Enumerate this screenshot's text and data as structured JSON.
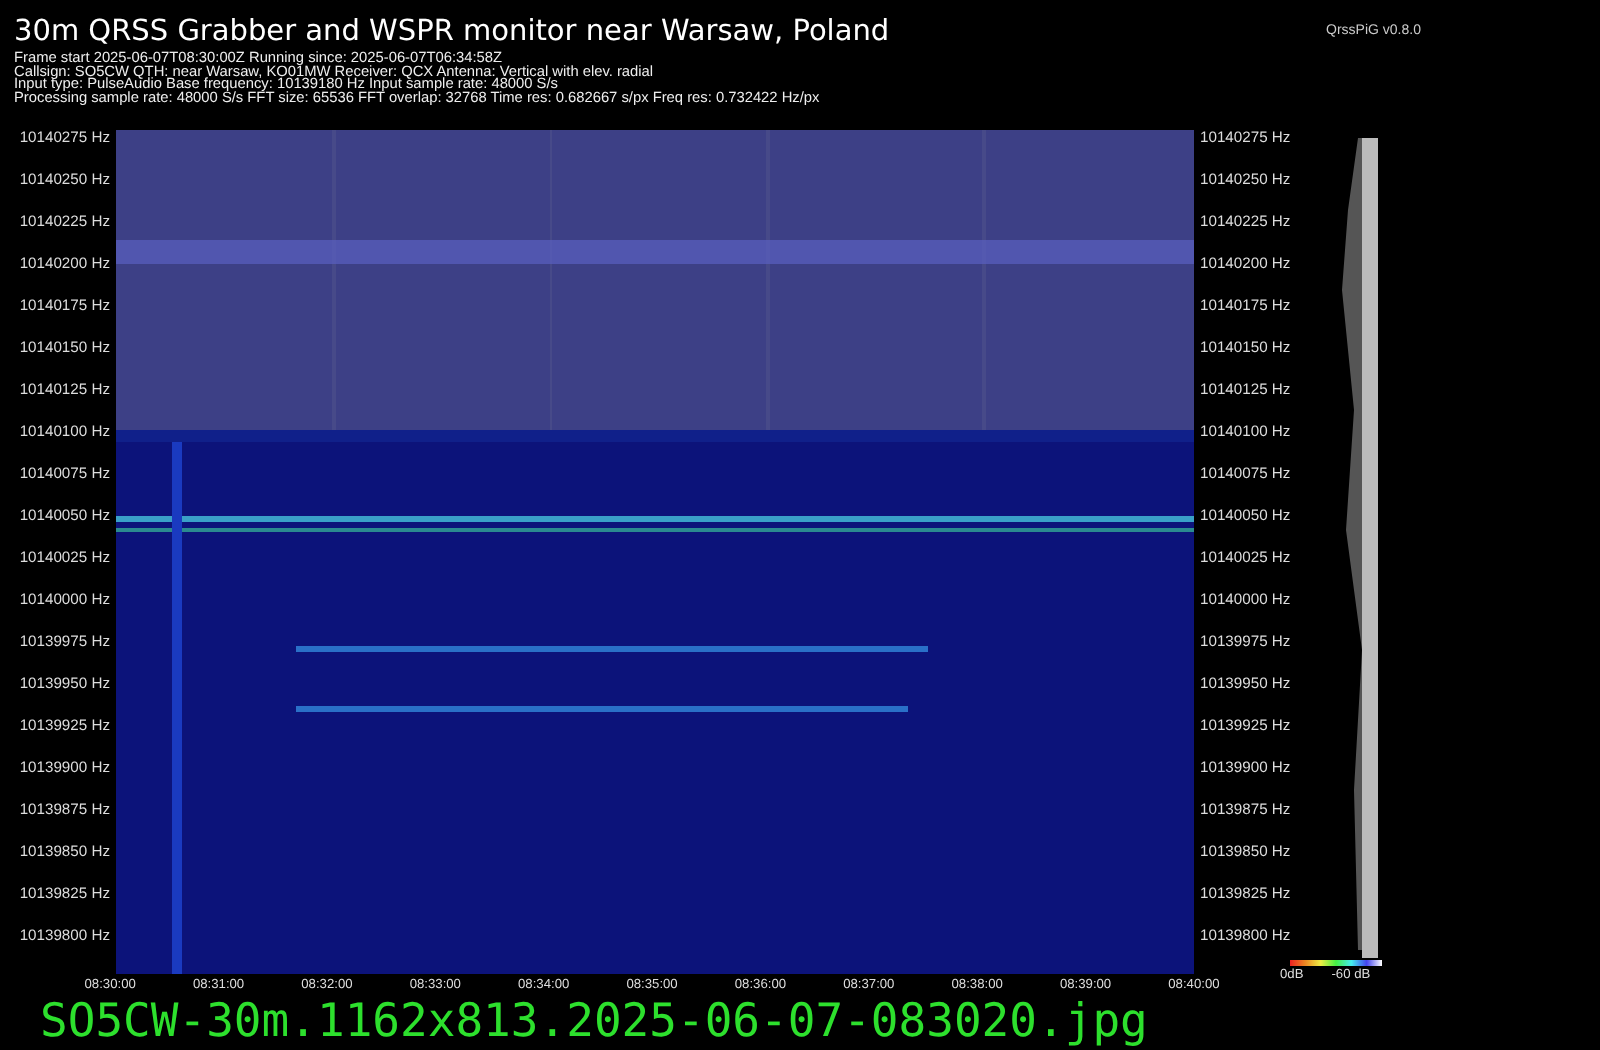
{
  "title": "30m QRSS Grabber and WSPR monitor near Warsaw, Poland",
  "version": "QrssPiG v0.8.0",
  "info_lines": [
    "Frame start 2025-06-07T08:30:00Z Running since: 2025-06-07T06:34:58Z",
    "Callsign: SO5CW QTH: near Warsaw, KO01MW Receiver: QCX Antenna: Vertical with elev. radial",
    "Input type: PulseAudio Base frequency: 10139180 Hz Input sample rate: 48000 S/s",
    "Processing sample rate: 48000 S/s FFT size: 65536 FFT overlap: 32768 Time res: 0.682667 s/px Freq res: 0.732422 Hz/px"
  ],
  "freq_axis_left": {
    "labels": [
      "10140275 Hz",
      "10140250 Hz",
      "10140225 Hz",
      "10140200 Hz",
      "10140175 Hz",
      "10140150 Hz",
      "10140125 Hz",
      "10140100 Hz",
      "10140075 Hz",
      "10140050 Hz",
      "10140025 Hz",
      "10140000 Hz",
      "10139975 Hz",
      "10139950 Hz",
      "10139925 Hz",
      "10139900 Hz",
      "10139875 Hz",
      "10139850 Hz",
      "10139825 Hz",
      "10139800 Hz"
    ]
  },
  "freq_axis_right": {
    "labels": [
      "10140275 Hz",
      "10140250 Hz",
      "10140225 Hz",
      "10140200 Hz",
      "10140175 Hz",
      "10140150 Hz",
      "10140125 Hz",
      "10140100 Hz",
      "10140075 Hz",
      "10140050 Hz",
      "10140025 Hz",
      "10140000 Hz",
      "10139975 Hz",
      "10139950 Hz",
      "10139925 Hz",
      "10139900 Hz",
      "10139875 Hz",
      "10139850 Hz",
      "10139825 Hz",
      "10139800 Hz"
    ]
  },
  "time_axis": {
    "labels": [
      "08:30:00",
      "08:31:00",
      "08:32:00",
      "08:33:00",
      "08:34:00",
      "08:35:00",
      "08:36:00",
      "08:37:00",
      "08:38:00",
      "08:39:00",
      "08:40:00"
    ]
  },
  "colorbar": {
    "labels": [
      "0dB",
      "-60 dB"
    ]
  },
  "filename": "SO5CW-30m.1162x813.2025-06-07-083020.jpg"
}
